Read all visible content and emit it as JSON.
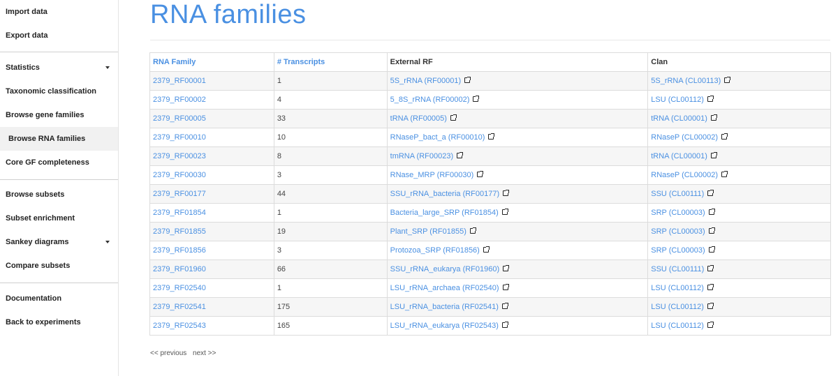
{
  "sidebar": {
    "items": [
      {
        "label": "Import data"
      },
      {
        "label": "Export data"
      },
      {
        "label": "Statistics"
      },
      {
        "label": "Taxonomic classification"
      },
      {
        "label": "Browse gene families"
      },
      {
        "label": "Browse RNA families"
      },
      {
        "label": "Core GF completeness"
      },
      {
        "label": "Browse subsets"
      },
      {
        "label": "Subset enrichment"
      },
      {
        "label": "Sankey diagrams"
      },
      {
        "label": "Compare subsets"
      },
      {
        "label": "Documentation"
      },
      {
        "label": "Back to experiments"
      }
    ],
    "active": "Browse RNA families"
  },
  "main": {
    "title": "RNA families",
    "table": {
      "headers": [
        "RNA Family",
        "# Transcripts",
        "External RF",
        "Clan"
      ],
      "rows": [
        [
          "2379_RF00001",
          "1",
          "5S_rRNA (RF00001)",
          "5S_rRNA (CL00113)"
        ],
        [
          "2379_RF00002",
          "4",
          "5_8S_rRNA (RF00002)",
          "LSU (CL00112)"
        ],
        [
          "2379_RF00005",
          "33",
          "tRNA (RF00005)",
          "tRNA (CL00001)"
        ],
        [
          "2379_RF00010",
          "10",
          "RNaseP_bact_a (RF00010)",
          "RNaseP (CL00002)"
        ],
        [
          "2379_RF00023",
          "8",
          "tmRNA (RF00023)",
          "tRNA (CL00001)"
        ],
        [
          "2379_RF00030",
          "3",
          "RNase_MRP (RF00030)",
          "RNaseP (CL00002)"
        ],
        [
          "2379_RF00177",
          "44",
          "SSU_rRNA_bacteria (RF00177)",
          "SSU (CL00111)"
        ],
        [
          "2379_RF01854",
          "1",
          "Bacteria_large_SRP (RF01854)",
          "SRP (CL00003)"
        ],
        [
          "2379_RF01855",
          "19",
          "Plant_SRP (RF01855)",
          "SRP (CL00003)"
        ],
        [
          "2379_RF01856",
          "3",
          "Protozoa_SRP (RF01856)",
          "SRP (CL00003)"
        ],
        [
          "2379_RF01960",
          "66",
          "SSU_rRNA_eukarya (RF01960)",
          "SSU (CL00111)"
        ],
        [
          "2379_RF02540",
          "1",
          "LSU_rRNA_archaea (RF02540)",
          "LSU (CL00112)"
        ],
        [
          "2379_RF02541",
          "175",
          "LSU_rRNA_bacteria (RF02541)",
          "LSU (CL00112)"
        ],
        [
          "2379_RF02543",
          "165",
          "LSU_rRNA_eukarya (RF02543)",
          "LSU (CL00112)"
        ]
      ]
    },
    "pager": {
      "previous": "<< previous",
      "next": "next >>"
    }
  },
  "colors": {
    "link": "#4a90e2",
    "active_bg": "#f1f1f1",
    "stripe": "#f6f6f6"
  },
  "icons": {
    "external_link": "external-link-icon",
    "dropdown": "caret-down-icon"
  }
}
